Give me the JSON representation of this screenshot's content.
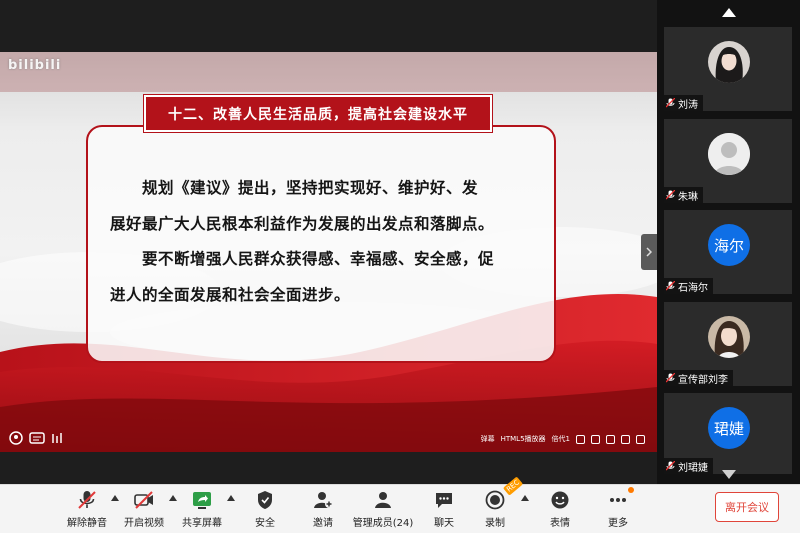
{
  "slide": {
    "site_logo": "bilibili",
    "title": "十二、改善人民生活品质，提高社会建设水平",
    "lines": [
      "规划《建议》提出，坚持把实现好、维护好、发",
      "展好最广大人民根本利益作为发展的出发点和落脚点。",
      "要不断增强人民群众获得感、幸福感、安全感，促",
      "进人的全面发展和社会全面进步。"
    ],
    "player_labels": [
      "弹幕",
      "HTML5播放器",
      "倍代1"
    ]
  },
  "participants": [
    {
      "name": "刘涛",
      "avatar_type": "photo"
    },
    {
      "name": "朱琳",
      "avatar_type": "default"
    },
    {
      "name": "石海尔",
      "avatar_type": "text",
      "avatar_text": "海尔"
    },
    {
      "name": "宣传部刘李",
      "avatar_type": "photo"
    },
    {
      "name": "刘珺婕",
      "avatar_type": "text",
      "avatar_text": "珺婕"
    }
  ],
  "toolbar": {
    "unmute": "解除静音",
    "video": "开启视频",
    "share": "共享屏幕",
    "security": "安全",
    "invite": "邀请",
    "members": "管理成员(24)",
    "chat": "聊天",
    "record": "录制",
    "record_badge": "REC",
    "reactions": "表情",
    "more": "更多",
    "leave": "离开会议"
  },
  "colors": {
    "slide_red": "#b3121a",
    "avatar_blue": "#0f6fe6",
    "leave_red": "#e0453a",
    "share_green": "#2e9e47",
    "badge_orange": "#ff9d00"
  }
}
